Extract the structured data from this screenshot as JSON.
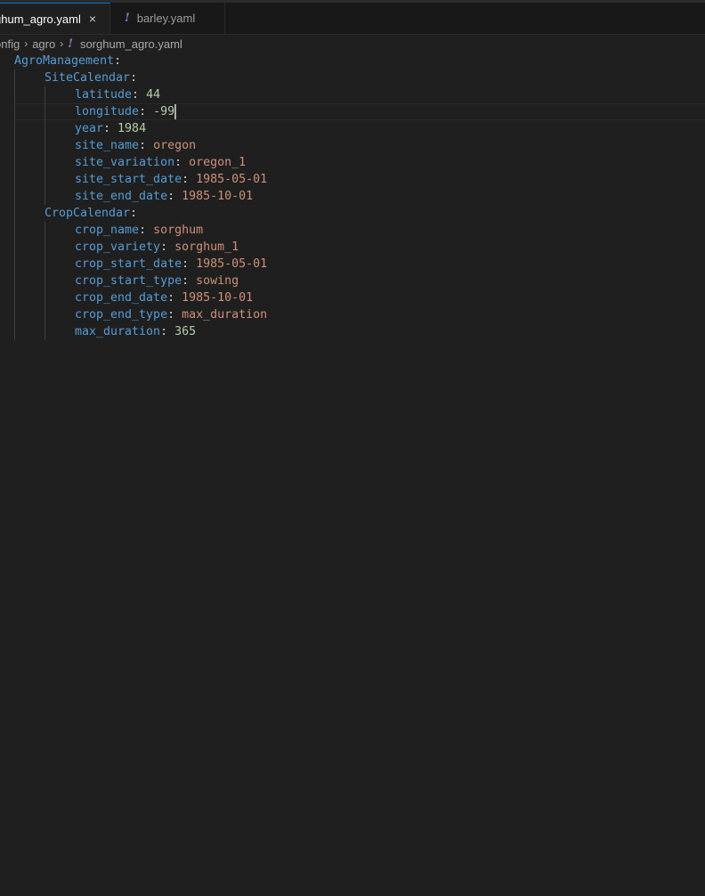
{
  "tabs": [
    {
      "label": "sorghum_agro.yaml",
      "visible_label": "ghum_agro.yaml",
      "active": true,
      "close_glyph": "×"
    },
    {
      "label": "barley.yaml",
      "active": false,
      "icon": "yaml-exclamation-icon"
    }
  ],
  "breadcrumb": {
    "parts": [
      "onfig",
      "agro",
      "sorghum_agro.yaml"
    ],
    "separator": "›"
  },
  "editor": {
    "lines": [
      {
        "indent": 0,
        "key": "AgroManagement",
        "value": "",
        "type": "none"
      },
      {
        "indent": 1,
        "key": "SiteCalendar",
        "value": "",
        "type": "none"
      },
      {
        "indent": 2,
        "key": "latitude",
        "value": "44",
        "type": "num"
      },
      {
        "indent": 2,
        "key": "longitude",
        "value": "-99",
        "type": "num",
        "cursor": true
      },
      {
        "indent": 2,
        "key": "year",
        "value": "1984",
        "type": "num"
      },
      {
        "indent": 2,
        "key": "site_name",
        "value": "oregon",
        "type": "str"
      },
      {
        "indent": 2,
        "key": "site_variation",
        "value": "oregon_1",
        "type": "str"
      },
      {
        "indent": 2,
        "key": "site_start_date",
        "value": "1985-05-01",
        "type": "str"
      },
      {
        "indent": 2,
        "key": "site_end_date",
        "value": "1985-10-01",
        "type": "str"
      },
      {
        "indent": 1,
        "key": "CropCalendar",
        "value": "",
        "type": "none"
      },
      {
        "indent": 2,
        "key": "crop_name",
        "value": "sorghum",
        "type": "str"
      },
      {
        "indent": 2,
        "key": "crop_variety",
        "value": "sorghum_1",
        "type": "str"
      },
      {
        "indent": 2,
        "key": "crop_start_date",
        "value": "1985-05-01",
        "type": "str"
      },
      {
        "indent": 2,
        "key": "crop_start_type",
        "value": "sowing",
        "type": "str"
      },
      {
        "indent": 2,
        "key": "crop_end_date",
        "value": "1985-10-01",
        "type": "str"
      },
      {
        "indent": 2,
        "key": "crop_end_type",
        "value": "max_duration",
        "type": "str"
      },
      {
        "indent": 2,
        "key": "max_duration",
        "value": "365",
        "type": "num"
      }
    ]
  },
  "colors": {
    "key": "#569cd6",
    "number": "#b5cea8",
    "string": "#ce9178",
    "yaml_icon": "#a074c4",
    "active_tab_border": "#0078d4",
    "background": "#1f1f1f"
  }
}
